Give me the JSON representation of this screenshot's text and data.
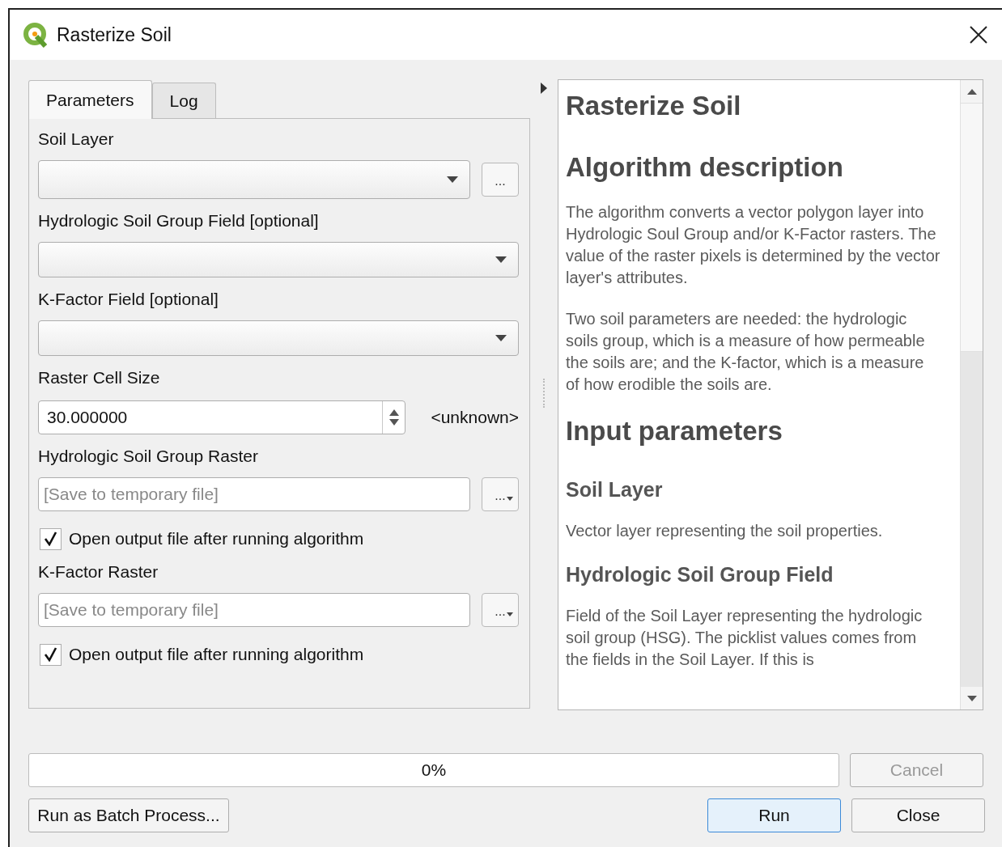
{
  "window": {
    "title": "Rasterize Soil"
  },
  "tabs": [
    {
      "label": "Parameters",
      "selected": true
    },
    {
      "label": "Log",
      "selected": false
    }
  ],
  "parameters": [
    {
      "kind": "combo",
      "label": "Soil Layer",
      "button": "..."
    },
    {
      "kind": "combo",
      "label": "Hydrologic Soil Group Field [optional]"
    },
    {
      "kind": "combo",
      "label": "K-Factor Field [optional]"
    },
    {
      "kind": "spin",
      "label": "Raster Cell Size",
      "value": "30.000000",
      "unit": "<unknown>"
    },
    {
      "kind": "file",
      "label": "Hydrologic Soil Group Raster",
      "placeholder": "[Save to temporary file]",
      "button": "...",
      "option": {
        "label": "Open output file after running algorithm",
        "checked": true
      }
    },
    {
      "kind": "file",
      "label": "K-Factor Raster",
      "placeholder": "[Save to temporary file]",
      "button": "...",
      "option": {
        "label": "Open output file after running algorithm",
        "checked": true
      }
    }
  ],
  "help": [
    {
      "kind": "title",
      "text": "Rasterize Soil"
    },
    {
      "kind": "heading",
      "text": "Algorithm description"
    },
    {
      "kind": "paragraph",
      "text": "The algorithm converts a vector polygon layer into Hydrologic Soul Group and/or K-Factor rasters. The value of the raster pixels is determined by the vector layer's attributes."
    },
    {
      "kind": "paragraph",
      "text": "Two soil parameters are needed: the hydrologic soils group, which is a measure of how permeable the soils are; and the K-factor, which is a measure of how erodible the soils are."
    },
    {
      "kind": "title",
      "text": "Input parameters"
    },
    {
      "kind": "heading2",
      "text": "Soil Layer"
    },
    {
      "kind": "paragraph",
      "text": "Vector layer representing the soil properties."
    },
    {
      "kind": "heading2",
      "text": "Hydrologic Soil Group Field"
    },
    {
      "kind": "paragraph",
      "text": "Field of the Soil Layer representing the hydrologic soil group (HSG). The picklist values comes from the fields in the Soil Layer. If this is"
    }
  ],
  "progress": {
    "level": 0,
    "text": "0%"
  },
  "buttons": [
    {
      "label": "Cancel",
      "disabled": true,
      "default": false
    },
    {
      "label": "Run as Batch Process...",
      "disabled": false,
      "default": false
    },
    {
      "label": "Run",
      "disabled": false,
      "default": true
    },
    {
      "label": "Close",
      "disabled": false,
      "default": false
    }
  ]
}
